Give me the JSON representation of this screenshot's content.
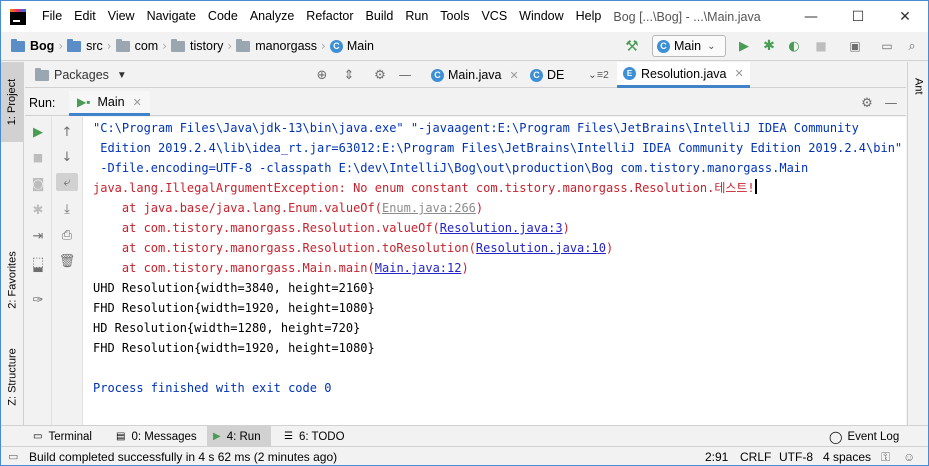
{
  "window": {
    "title": "Bog [...\\Bog] - ...\\Main.java",
    "controls": {
      "minimize": "—",
      "maximize": "☐",
      "close": "✕"
    }
  },
  "menu": [
    "File",
    "Edit",
    "View",
    "Navigate",
    "Code",
    "Analyze",
    "Refactor",
    "Build",
    "Run",
    "Tools",
    "VCS",
    "Window",
    "Help"
  ],
  "breadcrumb": [
    "Bog",
    "src",
    "com",
    "tistory",
    "manorgass",
    "Main"
  ],
  "run_config": {
    "selected": "Main"
  },
  "left_stripe": {
    "project": "1: Project",
    "favorites": "2: Favorites",
    "structure": "Z: Structure"
  },
  "right_stripe": {
    "ant": "Ant"
  },
  "packages_panel": {
    "label": "Packages"
  },
  "editor_tabs": [
    {
      "label": "Main.java",
      "icon": "C",
      "active": false
    },
    {
      "label": "DE",
      "icon": "E",
      "active": false
    },
    {
      "overflow": "≡2"
    },
    {
      "label": "Resolution.java",
      "icon": "E",
      "active": true
    }
  ],
  "run_panel": {
    "title": "Run:",
    "tab": "Main"
  },
  "console": {
    "lines": [
      {
        "text": "\"C:\\Program Files\\Java\\jdk-13\\bin\\java.exe\" \"-javaagent:E:\\Program Files\\JetBrains\\IntelliJ IDEA Community",
        "style": "navy"
      },
      {
        "text": " Edition 2019.2.4\\lib\\idea_rt.jar=63012:E:\\Program Files\\JetBrains\\IntelliJ IDEA Community Edition 2019.2.4\\bin\"",
        "style": "navy"
      },
      {
        "text": " -Dfile.encoding=UTF-8 -classpath E:\\dev\\IntelliJ\\Bog\\out\\production\\Bog com.tistory.manorgass.Main",
        "style": "navy"
      },
      {
        "text": "java.lang.IllegalArgumentException: No enum constant com.tistory.manorgass.Resolution.테스트!",
        "style": "err"
      },
      {
        "prefix": "    at java.base/java.lang.Enum.valueOf(",
        "link": "Enum.java:266",
        "suffix": ")",
        "style": "err",
        "link_style": "greylink"
      },
      {
        "prefix": "    at com.tistory.manorgass.Resolution.valueOf(",
        "link": "Resolution.java:3",
        "suffix": ")",
        "style": "err",
        "link_style": "link"
      },
      {
        "prefix": "    at com.tistory.manorgass.Resolution.toResolution(",
        "link": "Resolution.java:10",
        "suffix": ")",
        "style": "err",
        "link_style": "link"
      },
      {
        "prefix": "    at com.tistory.manorgass.Main.main(",
        "link": "Main.java:12",
        "suffix": ")",
        "style": "err",
        "link_style": "link"
      },
      {
        "text": "UHD Resolution{width=3840, height=2160}",
        "style": "plain"
      },
      {
        "text": "FHD Resolution{width=1920, height=1080}",
        "style": "plain"
      },
      {
        "text": "HD Resolution{width=1280, height=720}",
        "style": "plain"
      },
      {
        "text": "FHD Resolution{width=1920, height=1080}",
        "style": "plain"
      },
      {
        "text": "",
        "style": "plain"
      },
      {
        "text": "Process finished with exit code 0",
        "style": "navy"
      }
    ]
  },
  "bottom_tabs": [
    {
      "label": "Terminal",
      "active": false
    },
    {
      "label": "0: Messages",
      "active": false
    },
    {
      "label": "4: Run",
      "active": true
    },
    {
      "label": "6: TODO",
      "active": false
    }
  ],
  "event_log": "Event Log",
  "status": {
    "message": "Build completed successfully in 4 s 62 ms (2 minutes ago)",
    "position": "2:91",
    "line_sep": "CRLF",
    "encoding": "UTF-8",
    "indent": "4 spaces"
  },
  "colors": {
    "accent": "#4083c9",
    "error": "#c7222d",
    "link": "#2323c7",
    "run_green": "#499c54"
  }
}
